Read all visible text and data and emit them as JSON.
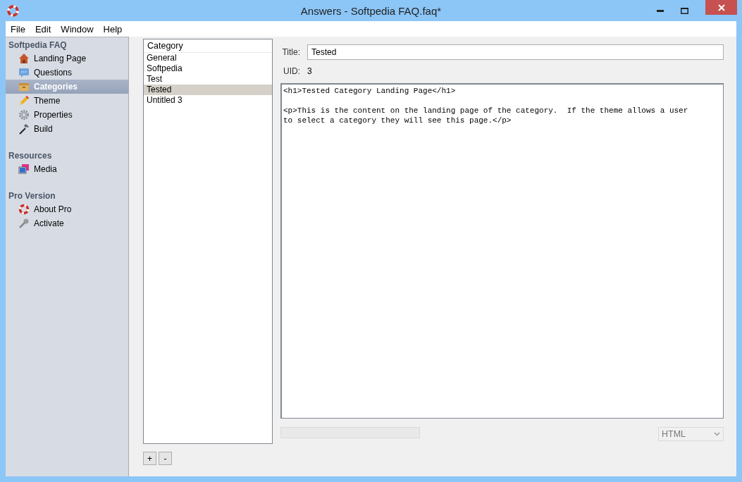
{
  "window": {
    "title": "Answers - Softpedia FAQ.faq*"
  },
  "menu": [
    "File",
    "Edit",
    "Window",
    "Help"
  ],
  "sidebar": {
    "sections": [
      {
        "title": "Softpedia FAQ",
        "items": [
          {
            "label": "Landing Page",
            "kind": "house",
            "selected": false
          },
          {
            "label": "Questions",
            "kind": "chat",
            "selected": false
          },
          {
            "label": "Categories",
            "kind": "box",
            "selected": true
          },
          {
            "label": "Theme",
            "kind": "pencil",
            "selected": false
          },
          {
            "label": "Properties",
            "kind": "gear",
            "selected": false
          },
          {
            "label": "Build",
            "kind": "hammer",
            "selected": false
          }
        ]
      },
      {
        "title": "Resources",
        "items": [
          {
            "label": "Media",
            "kind": "media",
            "selected": false
          }
        ]
      },
      {
        "title": "Pro Version",
        "items": [
          {
            "label": "About Pro",
            "kind": "lifebuoy",
            "selected": false
          },
          {
            "label": "Activate",
            "kind": "key",
            "selected": false
          }
        ]
      }
    ]
  },
  "category_list": {
    "header": "Category",
    "items": [
      {
        "label": "General",
        "selected": false
      },
      {
        "label": "Softpedia",
        "selected": false
      },
      {
        "label": "Test",
        "selected": false
      },
      {
        "label": "Tested",
        "selected": true
      },
      {
        "label": "Untitled 3",
        "selected": false
      }
    ],
    "buttons": [
      "+",
      "-"
    ]
  },
  "details": {
    "title_label": "Title:",
    "title_value": "Tested",
    "uid_label": "UID:",
    "uid_value": "3",
    "content": "<h1>Tested Category Landing Page</h1>\n\n<p>This is the content on the landing page of the category.  If the theme allows a user\nto select a category they will see this page.</p>",
    "progress": {
      "level": 0
    },
    "format": "HTML"
  }
}
